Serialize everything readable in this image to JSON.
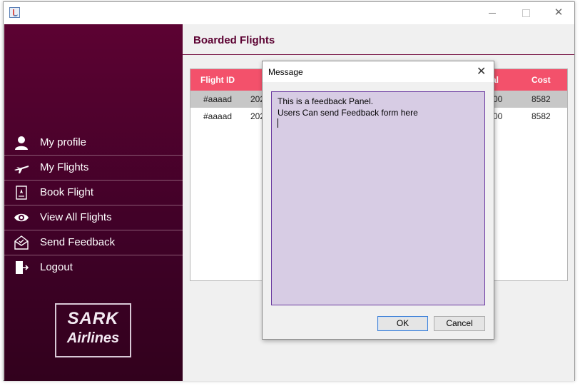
{
  "window": {
    "title": ""
  },
  "sidebar": {
    "items": [
      {
        "label": "My profile",
        "icon": "user-icon"
      },
      {
        "label": "My Flights",
        "icon": "plane-icon"
      },
      {
        "label": "Book Flight",
        "icon": "ticket-icon"
      },
      {
        "label": "View All Flights",
        "icon": "eye-icon"
      },
      {
        "label": "Send Feedback",
        "icon": "feedback-icon"
      },
      {
        "label": "Logout",
        "icon": "logout-icon"
      }
    ],
    "logo": {
      "line1": "SARK",
      "line2": "Airlines"
    }
  },
  "main": {
    "title": "Boarded Flights",
    "table": {
      "headers": [
        "Flight ID",
        "al",
        "Cost"
      ],
      "rows": [
        {
          "flight_id": "#aaaad",
          "date": "202",
          "arrival": "00",
          "cost": "8582",
          "selected": true
        },
        {
          "flight_id": "#aaaad",
          "date": "202",
          "arrival": "00",
          "cost": "8582",
          "selected": false
        }
      ],
      "header_color": "#f3516b"
    }
  },
  "dialog": {
    "title": "Message",
    "text_line1": "This is a feedback Panel.",
    "text_line2": "Users Can send Feedback form here",
    "ok_label": "OK",
    "cancel_label": "Cancel"
  },
  "colors": {
    "sidebar_top": "#5c0232",
    "sidebar_bottom": "#32011d",
    "accent": "#5c0232",
    "feedback_bg": "#d7cce4"
  }
}
